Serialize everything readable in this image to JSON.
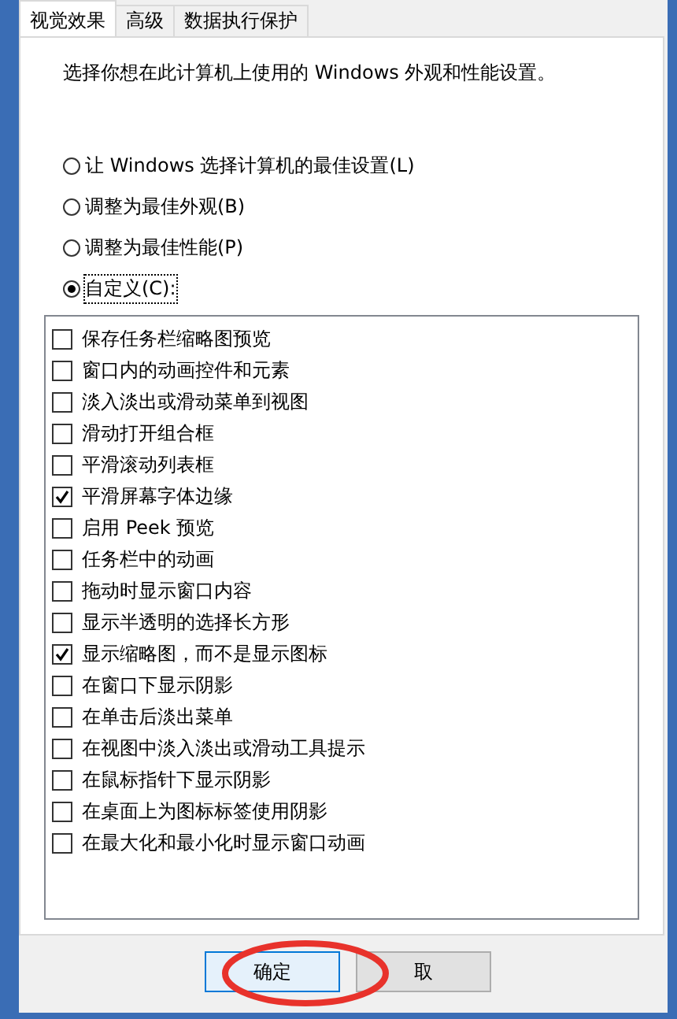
{
  "tabs": [
    {
      "label": "视觉效果",
      "selected": true
    },
    {
      "label": "高级",
      "selected": false
    },
    {
      "label": "数据执行保护",
      "selected": false
    }
  ],
  "description": "选择你想在此计算机上使用的 Windows 外观和性能设置。",
  "options": [
    {
      "label": "让 Windows 选择计算机的最佳设置(L)",
      "selected": false
    },
    {
      "label": "调整为最佳外观(B)",
      "selected": false
    },
    {
      "label": "调整为最佳性能(P)",
      "selected": false
    },
    {
      "label": "自定义(C):",
      "selected": true
    }
  ],
  "effects": [
    {
      "label": "保存任务栏缩略图预览",
      "checked": false
    },
    {
      "label": "窗口内的动画控件和元素",
      "checked": false
    },
    {
      "label": "淡入淡出或滑动菜单到视图",
      "checked": false
    },
    {
      "label": "滑动打开组合框",
      "checked": false
    },
    {
      "label": "平滑滚动列表框",
      "checked": false
    },
    {
      "label": "平滑屏幕字体边缘",
      "checked": true
    },
    {
      "label": "启用 Peek 预览",
      "checked": false
    },
    {
      "label": "任务栏中的动画",
      "checked": false
    },
    {
      "label": "拖动时显示窗口内容",
      "checked": false
    },
    {
      "label": "显示半透明的选择长方形",
      "checked": false
    },
    {
      "label": "显示缩略图，而不是显示图标",
      "checked": true
    },
    {
      "label": "在窗口下显示阴影",
      "checked": false
    },
    {
      "label": "在单击后淡出菜单",
      "checked": false
    },
    {
      "label": "在视图中淡入淡出或滑动工具提示",
      "checked": false
    },
    {
      "label": "在鼠标指针下显示阴影",
      "checked": false
    },
    {
      "label": "在桌面上为图标标签使用阴影",
      "checked": false
    },
    {
      "label": "在最大化和最小化时显示窗口动画",
      "checked": false
    }
  ],
  "buttons": [
    {
      "label": "确定",
      "highlighted": true
    },
    {
      "label": "取",
      "highlighted": false
    }
  ]
}
